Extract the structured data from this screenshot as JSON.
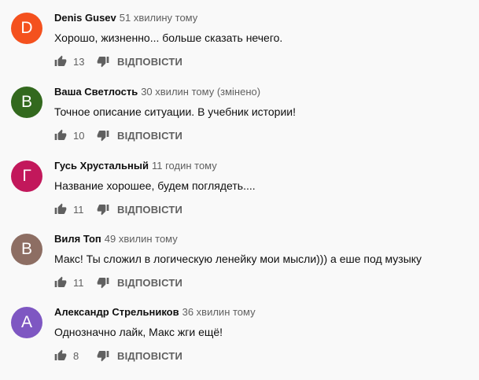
{
  "comments": [
    {
      "initial": "D",
      "avatar_color": "#f4511e",
      "author": "Denis Gusev",
      "time": "51 хвилину тому",
      "text": "Хорошо, жизненно... больше сказать нечего.",
      "likes": "13",
      "reply_label": "ВІДПОВІСТИ"
    },
    {
      "initial": "В",
      "avatar_color": "#33691e",
      "author": "Ваша Светлость",
      "time": "30 хвилин тому (змінено)",
      "text": "Точное описание ситуации. В учебник истории!",
      "likes": "10",
      "reply_label": "ВІДПОВІСТИ"
    },
    {
      "initial": "Г",
      "avatar_color": "#c2185b",
      "author": "Гусь Хрустальный",
      "time": "11 годин тому",
      "text": "Название хорошее, будем поглядеть....",
      "likes": "11",
      "reply_label": "ВІДПОВІСТИ"
    },
    {
      "initial": "В",
      "avatar_color": "#8d6e63",
      "author": "Виля Топ",
      "time": "49 хвилин тому",
      "text": "Макс! Ты сложил в логическую ленейку мои мысли))) а еше под музыку",
      "likes": "11",
      "reply_label": "ВІДПОВІСТИ"
    },
    {
      "initial": "А",
      "avatar_color": "#7e57c2",
      "author": "Александр Стрельников",
      "time": "36 хвилин тому",
      "text": "Однозначно лайк, Макс жги ещё!",
      "likes": "8",
      "reply_label": "ВІДПОВІСТИ"
    }
  ],
  "icons": {
    "like": "thumb-up-icon",
    "dislike": "thumb-down-icon"
  }
}
